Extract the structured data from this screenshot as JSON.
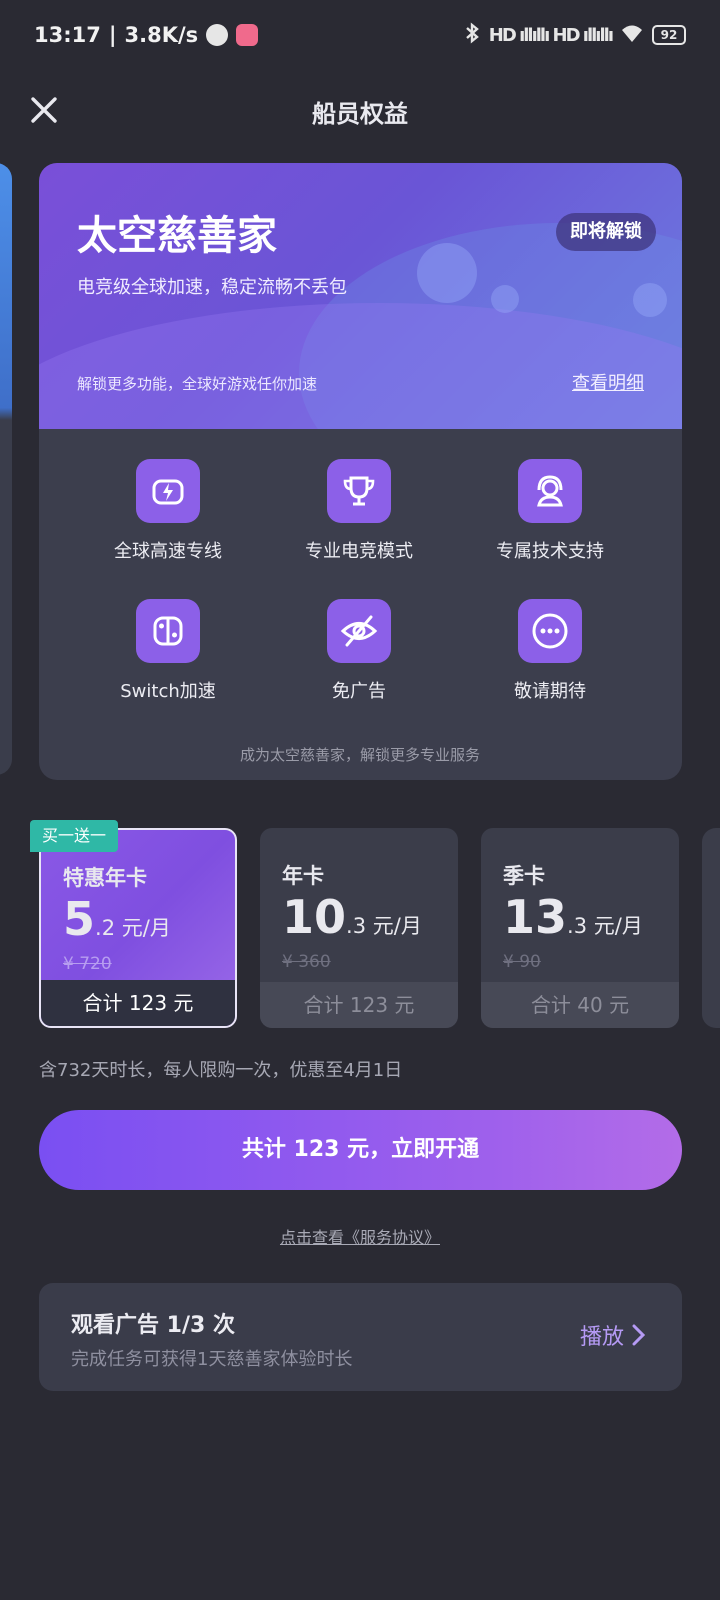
{
  "status_bar": {
    "time": "13:17",
    "speed": "3.8K/s",
    "battery": "92",
    "signal": "HD ıllıllı HD ıllıllı"
  },
  "header": {
    "title": "船员权益"
  },
  "hero": {
    "title": "太空慈善家",
    "badge": "即将解锁",
    "subtitle": "电竞级全球加速，稳定流畅不丢包",
    "note": "解锁更多功能，全球好游戏任你加速",
    "detail_link": "查看明细"
  },
  "features": [
    {
      "label": "全球高速专线",
      "icon": "lightning-gamepad-icon"
    },
    {
      "label": "专业电竞模式",
      "icon": "trophy-icon"
    },
    {
      "label": "专属技术支持",
      "icon": "headset-support-icon"
    },
    {
      "label": "Switch加速",
      "icon": "switch-console-icon"
    },
    {
      "label": "免广告",
      "icon": "eye-off-icon"
    },
    {
      "label": "敬请期待",
      "icon": "more-dots-icon"
    }
  ],
  "features_footer": "成为太空慈善家，解锁更多专业服务",
  "promo_tag": "买一送一",
  "plans": [
    {
      "name": "特惠年卡",
      "price_int": "5",
      "price_dec": ".2",
      "unit": " 元/月",
      "original": "¥ 720",
      "total": "合计 123 元",
      "selected": true
    },
    {
      "name": "年卡",
      "price_int": "10",
      "price_dec": ".3",
      "unit": " 元/月",
      "original": "¥ 360",
      "total": "合计 123 元",
      "selected": false
    },
    {
      "name": "季卡",
      "price_int": "13",
      "price_dec": ".3",
      "unit": " 元/月",
      "original": "¥ 90",
      "total": "合计 40 元",
      "selected": false
    }
  ],
  "plan_desc": "含732天时长，每人限购一次，优惠至4月1日",
  "cta_label": "共计 123 元，立即开通",
  "agreement": "点击查看《服务协议》",
  "ad_task": {
    "title": "观看广告 1/3 次",
    "subtitle": "完成任务可获得1天慈善家体验时长",
    "action": "播放"
  },
  "colors": {
    "accent": "#8c60e8",
    "background": "#2a2a33",
    "card": "#3c3e4d",
    "promo": "#2fb8a6"
  }
}
